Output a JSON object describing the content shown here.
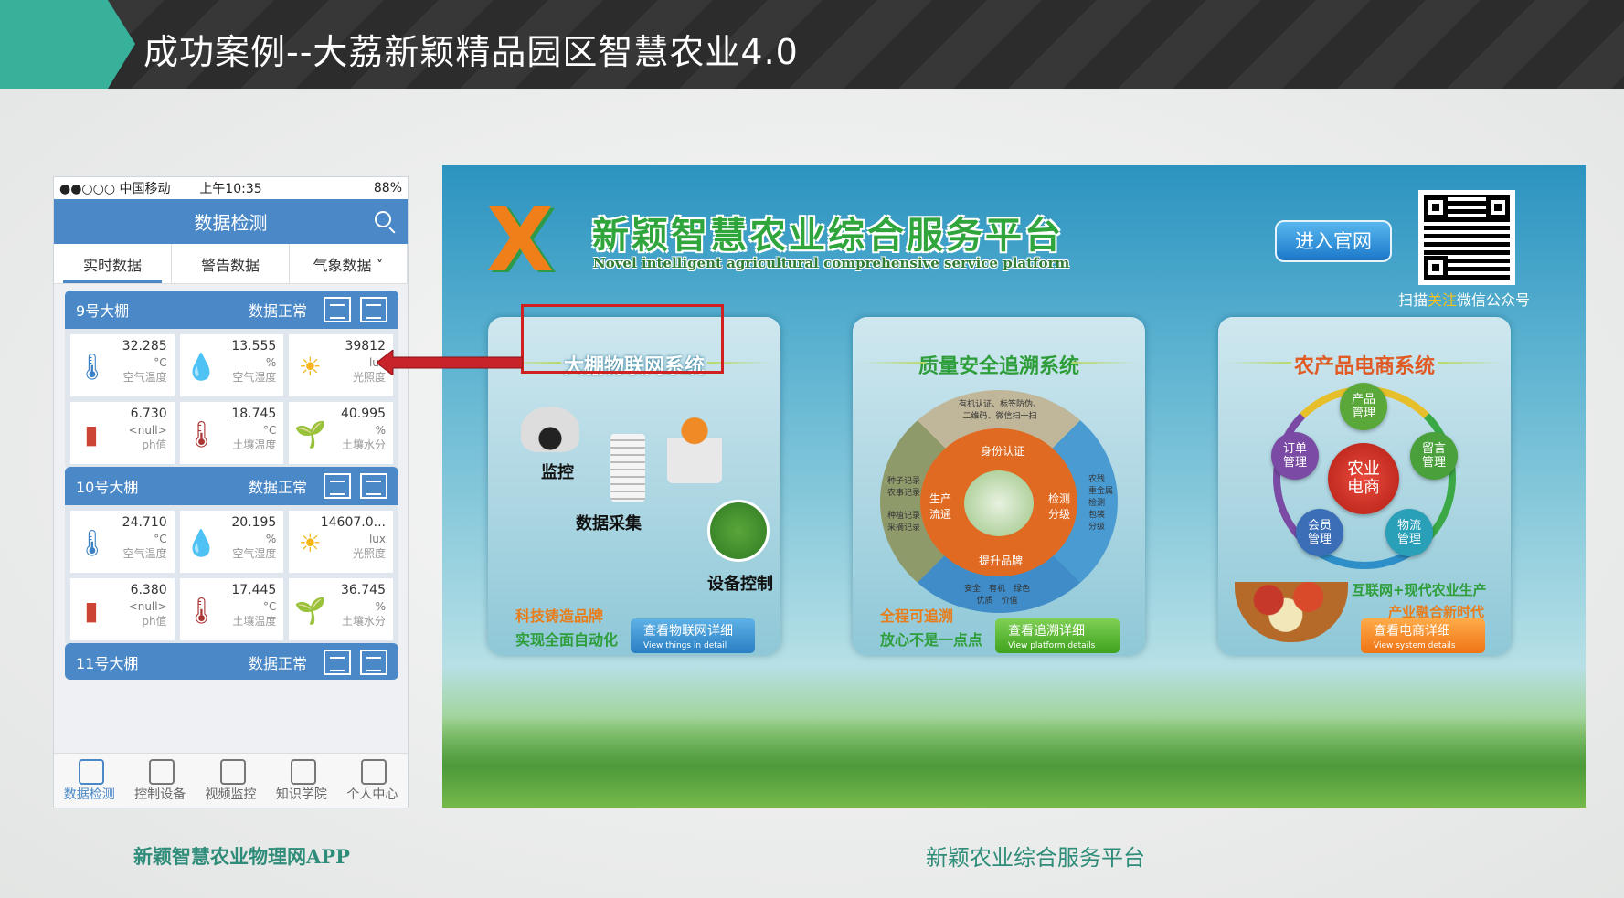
{
  "header": {
    "title": "成功案例--大荔新颖精品园区智慧农业4.0"
  },
  "phone": {
    "status": {
      "carrier": "●●○○○ 中国移动",
      "time": "上午10:35",
      "battery": "88%"
    },
    "nav_title": "数据检测",
    "tabs": [
      {
        "label": "实时数据"
      },
      {
        "label": "警告数据"
      },
      {
        "label": "气象数据 ˅"
      }
    ],
    "greenhouses": [
      {
        "name": "9号大棚",
        "status": "数据正常",
        "cells": [
          {
            "value": "32.285",
            "unit": "°C",
            "label": "空气温度"
          },
          {
            "value": "13.555",
            "unit": "%",
            "label": "空气湿度"
          },
          {
            "value": "39812",
            "unit": "lux",
            "label": "光照度"
          },
          {
            "value": "6.730",
            "unit": "<null>",
            "label": "ph值"
          },
          {
            "value": "18.745",
            "unit": "°C",
            "label": "土壤温度"
          },
          {
            "value": "40.995",
            "unit": "%",
            "label": "土壤水分"
          }
        ]
      },
      {
        "name": "10号大棚",
        "status": "数据正常",
        "cells": [
          {
            "value": "24.710",
            "unit": "°C",
            "label": "空气温度"
          },
          {
            "value": "20.195",
            "unit": "%",
            "label": "空气湿度"
          },
          {
            "value": "14607.0...",
            "unit": "lux",
            "label": "光照度"
          },
          {
            "value": "6.380",
            "unit": "<null>",
            "label": "ph值"
          },
          {
            "value": "17.445",
            "unit": "°C",
            "label": "土壤温度"
          },
          {
            "value": "36.745",
            "unit": "%",
            "label": "土壤水分"
          }
        ]
      },
      {
        "name": "11号大棚",
        "status": "数据正常"
      }
    ],
    "bottom_nav": [
      {
        "label": "数据检测"
      },
      {
        "label": "控制设备"
      },
      {
        "label": "视频监控"
      },
      {
        "label": "知识学院"
      },
      {
        "label": "个人中心"
      }
    ],
    "caption": "新颖智慧农业物理网APP"
  },
  "platform": {
    "logo_letter": "X",
    "title": "新颖智慧农业综合服务平台",
    "subtitle": "Novel intelligent agricultural comprehensive service platform",
    "enter_button": "进入官网",
    "qr_caption_a": "扫描",
    "qr_caption_b": "关注",
    "qr_caption_c": "微信公众号",
    "panels": [
      {
        "title": "大棚物联网系统",
        "labels": [
          "监控",
          "数据采集",
          "设备控制"
        ],
        "slogan1": "科技铸造品牌",
        "slogan2": "实现全面自动化",
        "button": "查看物联网详细",
        "button_sub": "View things in detail",
        "tag": "物联网"
      },
      {
        "title": "质量安全追溯系统",
        "ring": {
          "top": "身份认证",
          "left": "生产\n流通",
          "right": "检测\n分级",
          "bottom": "提升品牌",
          "outer_top": "有机认证、标签防伪、\n二维码、微信扫一扫",
          "outer_left_a": "种子记录\n农事记录",
          "outer_left_b": "种植记录\n采摘记录",
          "outer_right": "农残\n重金属\n检测\n包装\n分级",
          "outer_bottom": "安全　有机　绿色\n优质　价值"
        },
        "slogan1": "全程可追溯",
        "slogan2": "放心不是一点点",
        "button": "查看追溯详细",
        "button_sub": "View platform details",
        "tag": "追溯"
      },
      {
        "title": "农产品电商系统",
        "center": "农业\n电商",
        "nodes": [
          "产品\n管理",
          "留言\n管理",
          "物流\n管理",
          "会员\n管理",
          "订单\n管理"
        ],
        "slogan1": "互联网+现代农业生产",
        "slogan2": "产业融合新时代",
        "button": "查看电商详细",
        "button_sub": "View system details",
        "tag": "电商"
      }
    ],
    "caption": "新颖农业综合服务平台"
  },
  "colors": {
    "accent": "#37b19a",
    "phone_blue": "#4a88c7",
    "caption_green": "#2f8c79",
    "highlight_red": "#d02020"
  }
}
